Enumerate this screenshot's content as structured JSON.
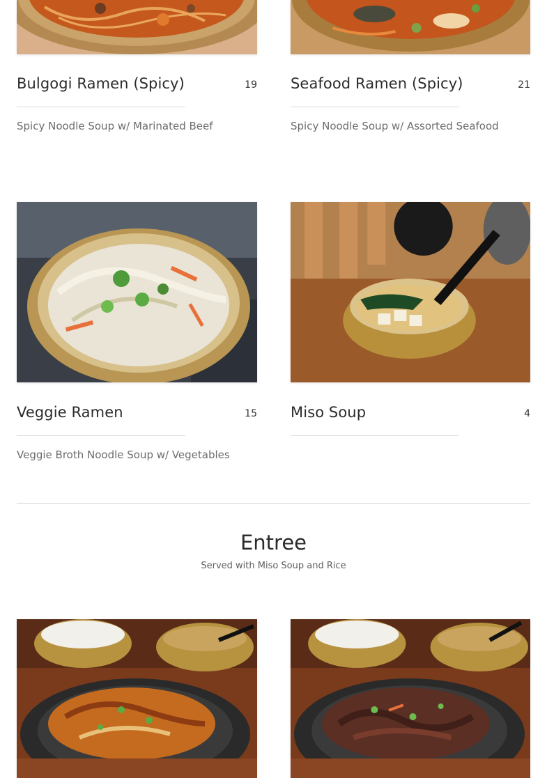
{
  "sections": [
    {
      "items": [
        {
          "name": "Bulgogi Ramen (Spicy)",
          "price": "19",
          "description": "Spicy Noodle Soup w/ Marinated Beef",
          "image": "spicy-ramen-bowl-photo"
        },
        {
          "name": "Seafood Ramen (Spicy)",
          "price": "21",
          "description": "Spicy Noodle Soup w/ Assorted Seafood",
          "image": "seafood-ramen-bowl-photo"
        },
        {
          "name": "Veggie Ramen",
          "price": "15",
          "description": "Veggie Broth Noodle Soup w/ Vegetables",
          "image": "veggie-ramen-bowl-photo"
        },
        {
          "name": "Miso Soup",
          "price": "4",
          "description": "",
          "image": "miso-soup-bowl-photo"
        }
      ]
    },
    {
      "title": "Entree",
      "subtitle": "Served with Miso Soup and Rice",
      "items": [
        {
          "image": "teriyaki-chicken-skillet-photo"
        },
        {
          "image": "beef-bulgogi-skillet-photo"
        }
      ]
    }
  ]
}
